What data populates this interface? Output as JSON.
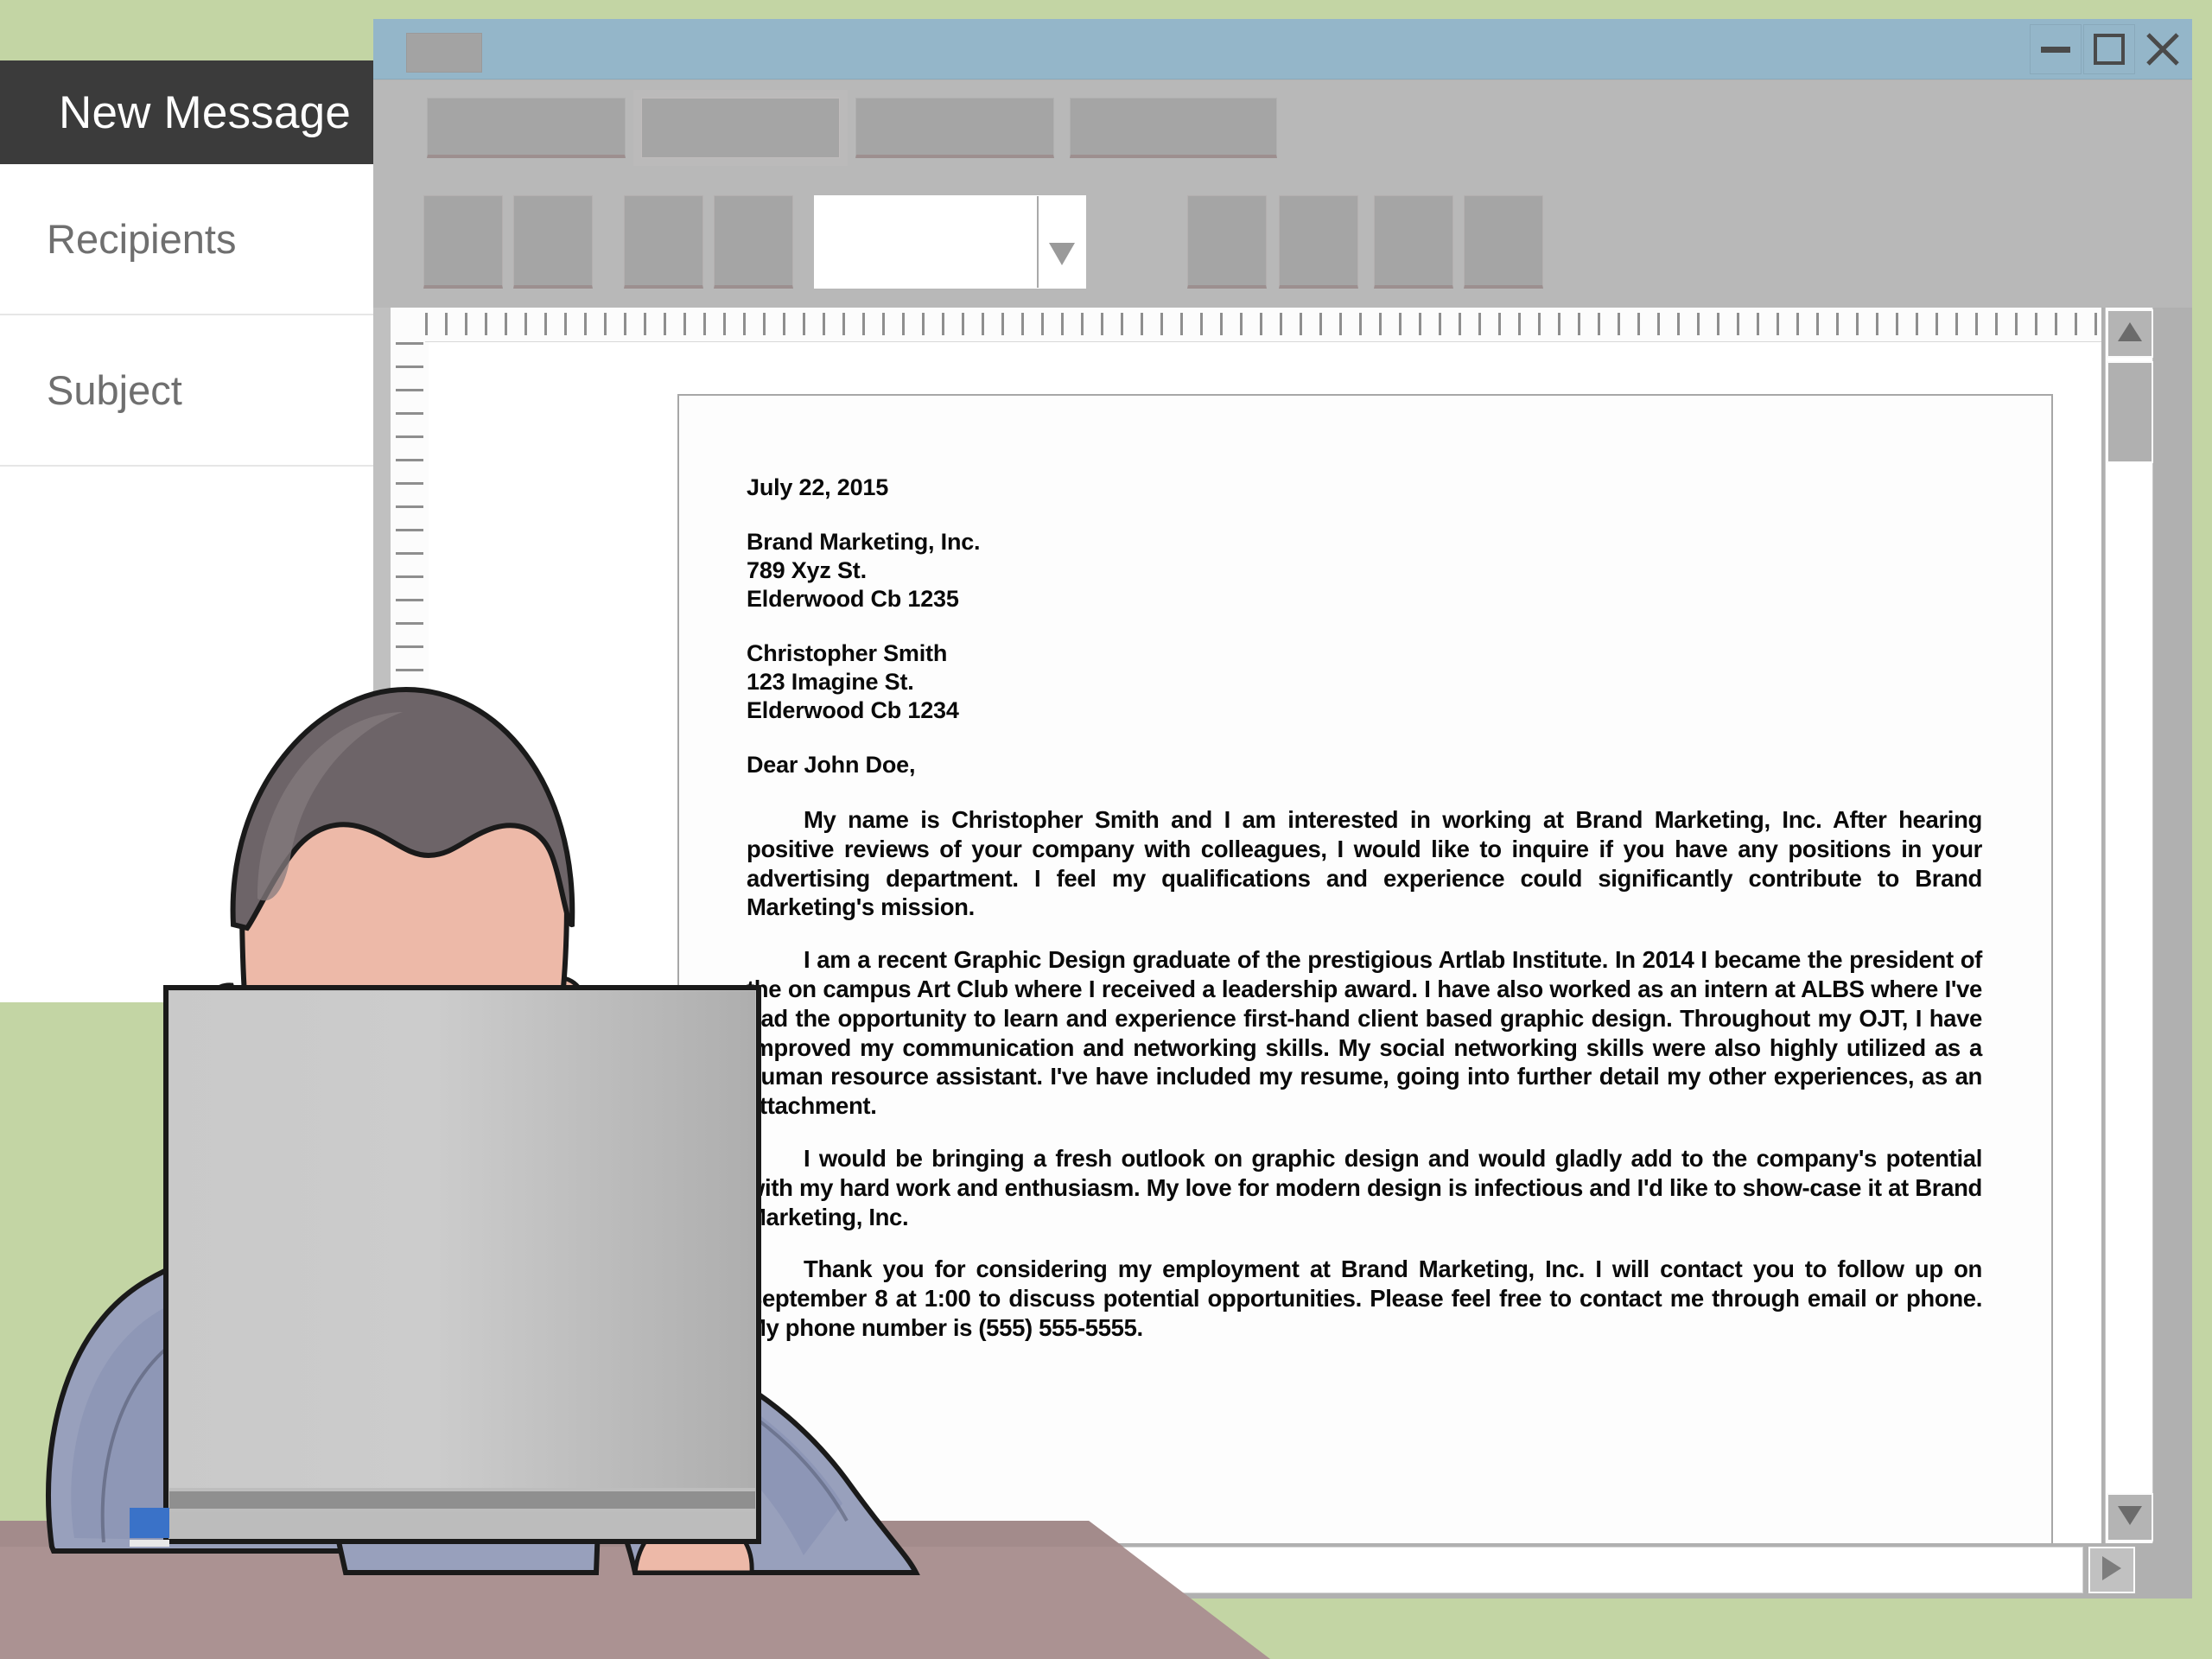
{
  "desktop": {
    "background_color": "#c3d5a4"
  },
  "compose": {
    "header_title": "New Message",
    "fields": [
      {
        "label": "Recipients",
        "name": "recipients"
      },
      {
        "label": "Subject",
        "name": "subject"
      }
    ],
    "header_bg": "#3b3b3b"
  },
  "doc_window": {
    "titlebar": {
      "color": "#94b6c9",
      "app_icon": "document-icon",
      "controls": [
        {
          "name": "minimize-button",
          "icon": "minimize-icon"
        },
        {
          "name": "maximize-button",
          "icon": "maximize-icon"
        },
        {
          "name": "close-button",
          "icon": "close-icon"
        }
      ]
    },
    "menubar": {
      "background": "#b8b8b8",
      "items": [
        {
          "name": "menu-file"
        },
        {
          "name": "menu-edit"
        },
        {
          "name": "menu-view"
        },
        {
          "name": "menu-format"
        }
      ]
    },
    "toolbar": {
      "background": "#b8b8b8",
      "buttons": [
        {
          "name": "toolbar-button-1"
        },
        {
          "name": "toolbar-button-2"
        },
        {
          "name": "toolbar-button-3"
        },
        {
          "name": "toolbar-button-4"
        },
        {
          "name": "toolbar-button-5"
        },
        {
          "name": "toolbar-button-6"
        },
        {
          "name": "toolbar-button-7"
        },
        {
          "name": "toolbar-button-8"
        }
      ],
      "font_combo": {
        "value": "",
        "placeholder": "",
        "arrow": "chevron-down-icon"
      }
    },
    "rulers": {
      "horizontal": true,
      "vertical": true
    },
    "scrollbars": {
      "vertical": {
        "up_icon": "triangle-up-icon",
        "down_icon": "triangle-down-icon",
        "thumb_position_pct": 4
      },
      "horizontal": {
        "left_icon": "triangle-left-icon",
        "right_icon": "triangle-right-icon",
        "thumb_position_pct": 0
      }
    }
  },
  "document": {
    "date": "July 22, 2015",
    "recipient_address": [
      "Brand Marketing, Inc.",
      "789 Xyz St.",
      "Elderwood Cb 1235"
    ],
    "sender_address": [
      "Christopher Smith",
      "123 Imagine St.",
      "Elderwood Cb 1234"
    ],
    "salutation": "Dear John Doe,",
    "paragraphs": [
      "My name is Christopher Smith and I am interested in working at Brand Marketing, Inc. After hearing positive reviews of your company with colleagues, I would like to inquire if you have any positions in your advertising department. I feel my qualifications and experience could significantly contribute to Brand Marketing's mission.",
      "I am a recent Graphic Design graduate of the prestigious Artlab Institute. In 2014 I became the president of the on campus Art Club where I received a leadership award. I have also worked as an intern at ALBS where I've had the opportunity to learn and experience first-hand client based graphic design. Throughout my OJT, I have improved my communication and networking skills. My social networking skills were also highly utilized as a human resource assistant. I've have included my resume, going into further detail my other experiences, as an attachment.",
      "I would be bringing a fresh outlook on graphic design and would gladly add to the company's potential with my hard work and enthusiasm. My love for modern design is infectious and I'd like to show-case it at Brand Marketing, Inc.",
      "Thank you for considering my employment at Brand Marketing, Inc. I will contact you to follow up on September 8 at 1:00 to discuss potential opportunities. Please feel free to contact me through email or phone. My phone number is (555) 555-5555."
    ]
  },
  "illustration": {
    "name": "man-at-laptop-illustration",
    "colors": {
      "skin": "#edb9a8",
      "skin_shadow": "#d9a193",
      "hair": "#6d6468",
      "shirt": "#98a0bc",
      "shirt_shadow": "#838cab",
      "laptop": "#b9b9b9",
      "desk": "#ab9292",
      "tie": "#7f9cc4"
    }
  }
}
